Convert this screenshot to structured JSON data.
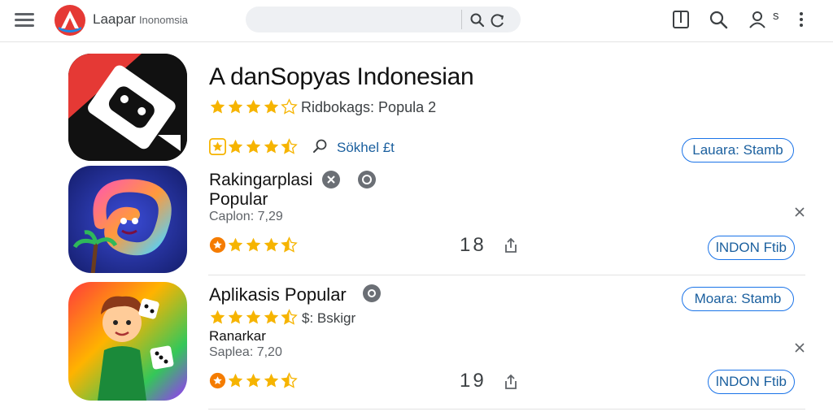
{
  "header": {
    "brand_main": "Laapar",
    "brand_sub": "Inonomsia",
    "search_placeholder": "",
    "icons": [
      "menu-icon",
      "logo-icon",
      "search-icon",
      "camera-search-icon",
      "bookmark-icon",
      "search-icon",
      "account-icon",
      "more-vert-icon"
    ],
    "account_suffix": "s"
  },
  "featured": {
    "title": "A danSopyas Indonesian",
    "rating_text": "Ridbokags: Popula 2",
    "rating_link": "Sökhel £t",
    "button": "Lauara: Stamb"
  },
  "items": [
    {
      "title": "Rakingarplasi",
      "subtitle": "Popular",
      "meta": "Caplon: 7,29",
      "count": "18",
      "button": "lNDON Ftib"
    },
    {
      "title": "Aplikasis Popular",
      "rating_text": "$: Bskigr",
      "subtitle": "Ranarkar",
      "meta": "Saplea: 7,20",
      "count": "19",
      "top_button": "Moara: Stamb",
      "button": "lNDON Ftib"
    }
  ],
  "colors": {
    "accent": "#1a73e8",
    "star": "#f6b400",
    "logo_red": "#e53935"
  }
}
